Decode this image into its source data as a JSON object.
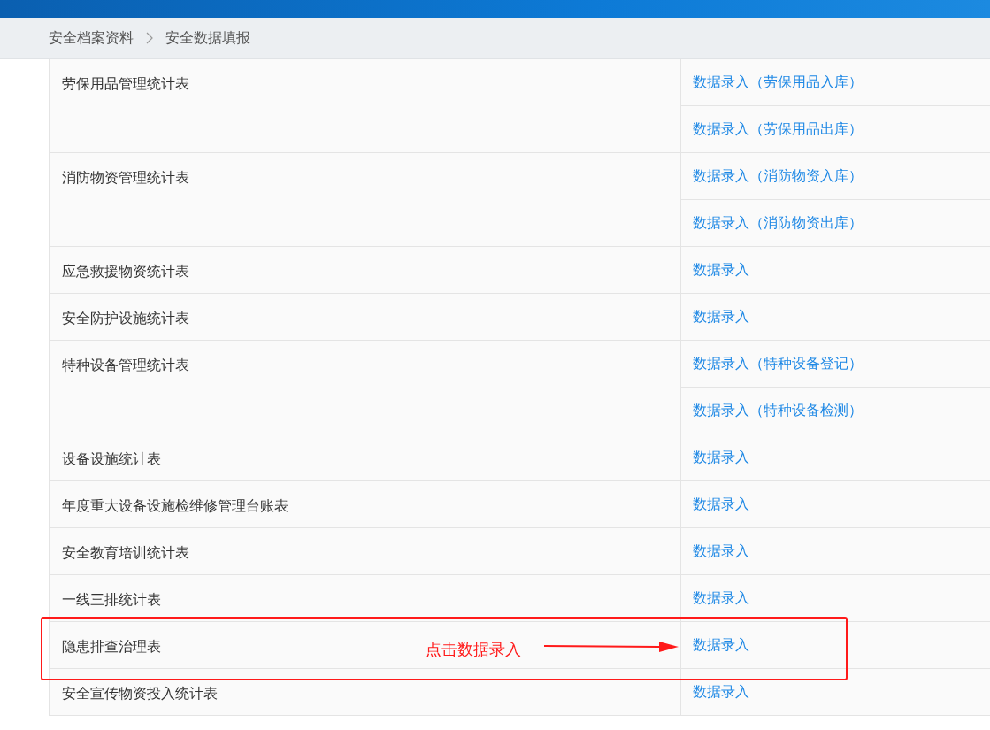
{
  "breadcrumb": [
    "安全档案资料",
    "安全数据填报"
  ],
  "rows": [
    {
      "name": "劳保用品管理统计表",
      "links": [
        "数据录入（劳保用品入库）",
        "数据录入（劳保用品出库）"
      ]
    },
    {
      "name": "消防物资管理统计表",
      "links": [
        "数据录入（消防物资入库）",
        "数据录入（消防物资出库）"
      ]
    },
    {
      "name": "应急救援物资统计表",
      "links": [
        "数据录入"
      ]
    },
    {
      "name": "安全防护设施统计表",
      "links": [
        "数据录入"
      ]
    },
    {
      "name": "特种设备管理统计表",
      "links": [
        "数据录入（特种设备登记）",
        "数据录入（特种设备检测）"
      ]
    },
    {
      "name": "设备设施统计表",
      "links": [
        "数据录入"
      ]
    },
    {
      "name": "年度重大设备设施检维修管理台账表",
      "links": [
        "数据录入"
      ]
    },
    {
      "name": "安全教育培训统计表",
      "links": [
        "数据录入"
      ]
    },
    {
      "name": "一线三排统计表",
      "links": [
        "数据录入"
      ]
    },
    {
      "name": "隐患排查治理表",
      "links": [
        "数据录入"
      ]
    },
    {
      "name": "安全宣传物资投入统计表",
      "links": [
        "数据录入"
      ]
    }
  ],
  "annotation": {
    "text": "点击数据录入"
  }
}
